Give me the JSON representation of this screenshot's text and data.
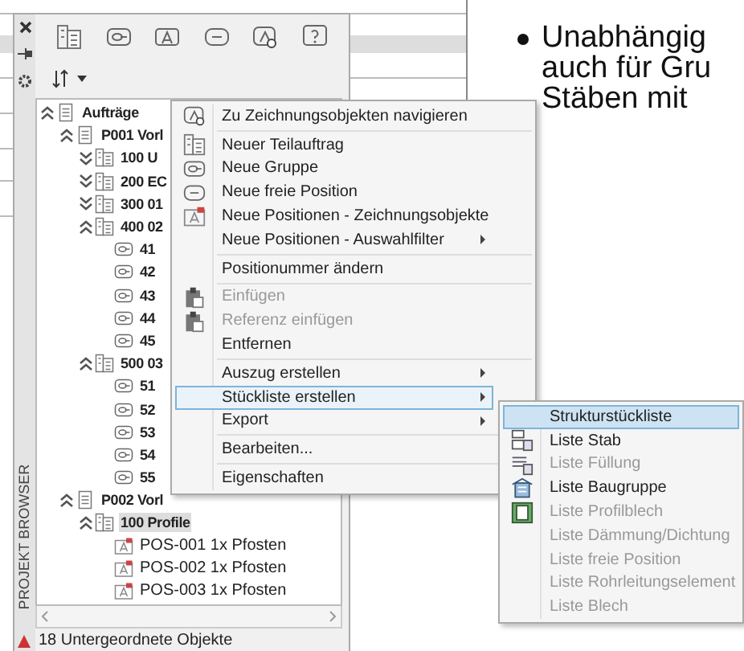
{
  "bullet_text": {
    "lines": [
      "Unabhängig",
      "auch für Gru",
      "Stäben mit"
    ]
  },
  "panel": {
    "side_title": "PROJEKT BROWSER",
    "tree": [
      {
        "label": "Aufträge",
        "kind": "order",
        "expanded": true,
        "selected": false,
        "children": [
          {
            "label": "P001 Vorl",
            "kind": "order",
            "expanded": true,
            "selected": false,
            "children": [
              {
                "label": "100 U",
                "kind": "part",
                "expanded": false,
                "selected": false
              },
              {
                "label": "200 EC",
                "kind": "part",
                "expanded": false,
                "selected": false
              },
              {
                "label": "300 01",
                "kind": "part",
                "expanded": false,
                "selected": false
              },
              {
                "label": "400 02",
                "kind": "part",
                "expanded": true,
                "selected": false,
                "children": [
                  {
                    "label": "41",
                    "kind": "group",
                    "selected": false
                  },
                  {
                    "label": "42",
                    "kind": "group",
                    "selected": false
                  },
                  {
                    "label": "43",
                    "kind": "group",
                    "selected": false
                  },
                  {
                    "label": "44",
                    "kind": "group",
                    "selected": false
                  },
                  {
                    "label": "45",
                    "kind": "group",
                    "selected": false
                  }
                ]
              },
              {
                "label": "500 03",
                "kind": "part",
                "expanded": true,
                "selected": false,
                "children": [
                  {
                    "label": "51",
                    "kind": "group",
                    "selected": false
                  },
                  {
                    "label": "52",
                    "kind": "group",
                    "selected": false
                  },
                  {
                    "label": "53",
                    "kind": "group",
                    "selected": false
                  },
                  {
                    "label": "54",
                    "kind": "group",
                    "selected": false
                  },
                  {
                    "label": "55",
                    "kind": "group",
                    "selected": false
                  }
                ]
              }
            ]
          },
          {
            "label": "P002 Vorl",
            "kind": "order",
            "expanded": true,
            "selected": false,
            "children": [
              {
                "label": "100 Profile",
                "kind": "part",
                "expanded": true,
                "selected": true,
                "children": [
                  {
                    "label": "POS-001 1x Pfosten",
                    "kind": "position",
                    "selected": false
                  },
                  {
                    "label": "POS-002 1x Pfosten",
                    "kind": "position",
                    "selected": false
                  },
                  {
                    "label": "POS-003 1x Pfosten",
                    "kind": "position",
                    "selected": false
                  }
                ]
              }
            ]
          }
        ]
      }
    ],
    "status": "18 Untergeordnete Objekte"
  },
  "context_menu": [
    {
      "kind": "navigate",
      "label": "Zu Zeichnungsobjekten navigieren",
      "disabled": false,
      "submenu": false,
      "highlighted": false
    },
    {
      "kind": "separator"
    },
    {
      "kind": "part",
      "label": "Neuer Teilauftrag",
      "disabled": false,
      "submenu": false,
      "highlighted": false
    },
    {
      "kind": "group",
      "label": "Neue Gruppe",
      "disabled": false,
      "submenu": false,
      "highlighted": false
    },
    {
      "kind": "free",
      "label": "Neue freie Position",
      "disabled": false,
      "submenu": false,
      "highlighted": false
    },
    {
      "kind": "position",
      "label": "Neue Positionen - Zeichnungsobjekte",
      "disabled": false,
      "submenu": false,
      "highlighted": false
    },
    {
      "kind": "plain",
      "label": "Neue Positionen - Auswahlfilter",
      "disabled": false,
      "submenu": true,
      "highlighted": false
    },
    {
      "kind": "separator"
    },
    {
      "kind": "plain",
      "label": "Positionummer ändern",
      "disabled": false,
      "submenu": false,
      "highlighted": false
    },
    {
      "kind": "separator"
    },
    {
      "kind": "paste",
      "label": "Einfügen",
      "disabled": true,
      "submenu": false,
      "highlighted": false
    },
    {
      "kind": "paste",
      "label": "Referenz einfügen",
      "disabled": true,
      "submenu": false,
      "highlighted": false
    },
    {
      "kind": "plain",
      "label": "Entfernen",
      "disabled": false,
      "submenu": false,
      "highlighted": false
    },
    {
      "kind": "separator"
    },
    {
      "kind": "plain",
      "label": "Auszug erstellen",
      "disabled": false,
      "submenu": true,
      "highlighted": false
    },
    {
      "kind": "plain",
      "label": "Stückliste erstellen",
      "disabled": false,
      "submenu": true,
      "highlighted": true
    },
    {
      "kind": "plain",
      "label": "Export",
      "disabled": false,
      "submenu": true,
      "highlighted": false
    },
    {
      "kind": "separator"
    },
    {
      "kind": "plain",
      "label": "Bearbeiten...",
      "disabled": false,
      "submenu": false,
      "highlighted": false
    },
    {
      "kind": "separator"
    },
    {
      "kind": "plain",
      "label": "Eigenschaften",
      "disabled": false,
      "submenu": false,
      "highlighted": false
    }
  ],
  "submenu": [
    {
      "kind": "plain",
      "label": "Strukturstückliste",
      "disabled": false,
      "highlighted": true
    },
    {
      "kind": "bar",
      "label": "Liste Stab",
      "disabled": false,
      "highlighted": false
    },
    {
      "kind": "fill",
      "label": "Liste Füllung",
      "disabled": true,
      "highlighted": false
    },
    {
      "kind": "assembly",
      "label": "Liste Baugruppe",
      "disabled": false,
      "highlighted": false
    },
    {
      "kind": "sheet",
      "label": "Liste Profilblech",
      "disabled": true,
      "highlighted": false
    },
    {
      "kind": "plain",
      "label": "Liste Dämmung/Dichtung",
      "disabled": true,
      "highlighted": false
    },
    {
      "kind": "plain",
      "label": "Liste freie Position",
      "disabled": true,
      "highlighted": false
    },
    {
      "kind": "plain",
      "label": "Liste Rohrleitungselement",
      "disabled": true,
      "highlighted": false
    },
    {
      "kind": "plain",
      "label": "Liste Blech",
      "disabled": true,
      "highlighted": false
    }
  ]
}
